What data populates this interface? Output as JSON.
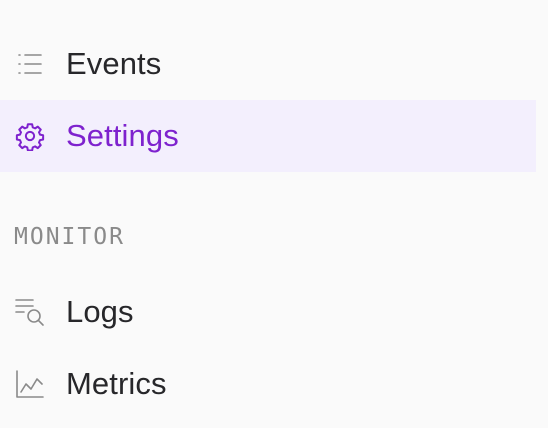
{
  "nav": {
    "items": [
      {
        "label": "Events",
        "icon": "list-icon",
        "active": false
      },
      {
        "label": "Settings",
        "icon": "gear-icon",
        "active": true
      }
    ]
  },
  "monitor": {
    "header": "MONITOR",
    "items": [
      {
        "label": "Logs",
        "icon": "log-search-icon",
        "active": false
      },
      {
        "label": "Metrics",
        "icon": "line-chart-icon",
        "active": false
      }
    ]
  },
  "colors": {
    "background": "#fafafa",
    "active_background": "#f3effd",
    "accent": "#7e22ce",
    "text": "#27272a",
    "muted": "#8a8a8a"
  }
}
